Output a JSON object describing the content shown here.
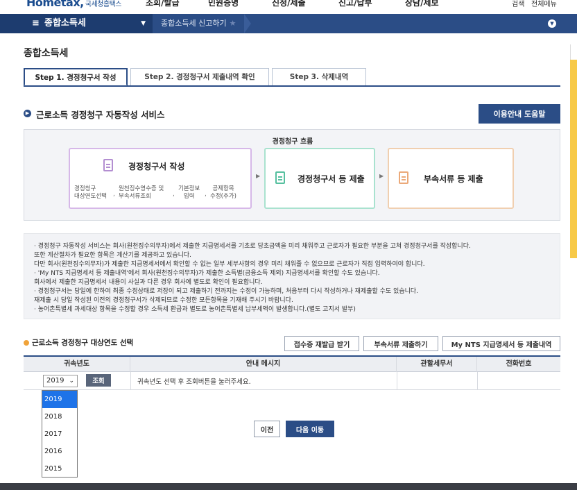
{
  "header": {
    "logo": "Hometax,",
    "logo_sub": "국세청홈택스",
    "menus": [
      "조회/발급",
      "민원증명",
      "신청/제출",
      "신고/납부",
      "상담/제보"
    ],
    "links": [
      "검색",
      "전체메뉴"
    ]
  },
  "nav": {
    "menu_label": "종합소득세",
    "breadcrumb": "종합소득세 신고하기",
    "star": "★"
  },
  "page": {
    "title": "종합소득세"
  },
  "tabs": [
    {
      "label": "Step 1. 경정청구서 작성",
      "active": true
    },
    {
      "label": "Step 2. 경정청구서 제출내역 확인",
      "active": false
    },
    {
      "label": "Step 3. 삭제내역",
      "active": false
    }
  ],
  "section": {
    "title": "근로소득 경정청구 자동작성 서비스",
    "help_button": "이용안내 도움말"
  },
  "flow": {
    "title": "경정청구 흐름",
    "step1": {
      "label": "경정청구서 작성",
      "subs": [
        {
          "l1": "경정청구",
          "l2": "대상연도선택"
        },
        {
          "l1": "원천징수영수증 및",
          "l2": "부속서류조회"
        },
        {
          "l1": "기본정보",
          "l2": "입력"
        },
        {
          "l1": "공제항목",
          "l2": "수정(추가)"
        }
      ]
    },
    "step2": {
      "label": "경정청구서 등 제출"
    },
    "step3": {
      "label": "부속서류 등 제출"
    }
  },
  "notice": {
    "lines": [
      "· 경정청구 자동작성 서비스는 회사(원천징수의무자)에서 제출한 지급명세서를 기초로 당초금액을 미리 채워주고 근로자가 필요한 부분을 고쳐 경정청구서를 작성합니다.",
      "   또한 계산절차가 필요한 항목은 계산기를 제공하고 있습니다.",
      "   다만 회사(원천징수의무자)가 제출한 지급명세서에서 확인할 수 없는 일부 세부사항의 경우 미리 채워줄 수 없으므로 근로자가 직접 입력하여야 합니다.",
      "· 'My NTS 지급명세서 등 제출내역'에서 회사(원천징수의무자)가 제출한 소득별(금융소득 제외) 지급명세서를 확인할 수도 있습니다.",
      "   회사에서 제출한 지급명세서 내용이 사실과 다른 경우 회사에 별도로 확인이 필요합니다.",
      "· 경정청구서는 당일에 한하여 최종 수정상태로 저장이 되고 제출하기 전까지는 수정이 가능하며, 처음부터 다시 작성하거나 재제출할 수도 있습니다.",
      "   재제출 시 당일 작성된 이전의 경정청구서가 삭제되므로 수정한 모든항목을 기재해 주시기 바랍니다.",
      "· 농어촌특별세 과세대상 항목을 수정할 경우 소득세 환급과 별도로 농어촌특별세 납부세액이 발생합니다.(별도 고지서 발부)"
    ]
  },
  "year_section": {
    "title": "근로소득 경정청구 대상연도 선택",
    "buttons": [
      "접수증 재발급 받기",
      "부속서류 제출하기",
      "My NTS 지급명세서 등 제출내역"
    ],
    "columns": [
      "귀속년도",
      "안내 메시지",
      "관할세무서",
      "전화번호"
    ],
    "selected_year": "2019",
    "lookup_button": "조회",
    "message": "귀속년도 선택 후 조회버튼을 눌러주세요.",
    "year_options": [
      "2019",
      "2018",
      "2017",
      "2016",
      "2015"
    ]
  },
  "actions": {
    "prev": "이전",
    "next": "다음 이동"
  }
}
